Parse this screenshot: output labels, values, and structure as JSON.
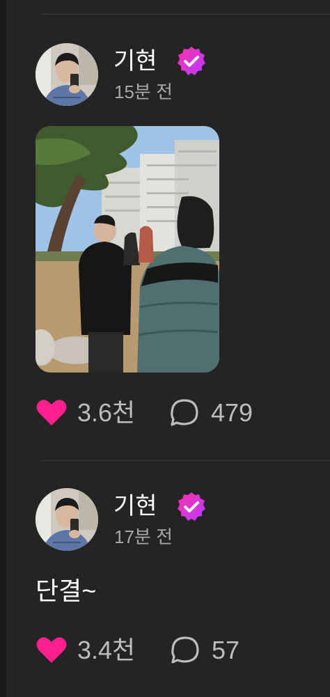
{
  "colors": {
    "background": "#242424",
    "like_heart": "#ff1f8e",
    "verified_badge": "#e23ce6",
    "muted_text": "#a8a8a8",
    "count_text": "#bdbdbd"
  },
  "posts": [
    {
      "author": "기현",
      "verified": true,
      "time": "15분 전",
      "text": "",
      "has_image": true,
      "likes": "3.6천",
      "comments": "479",
      "icons": [
        "avatar",
        "verified-badge-icon",
        "heart-icon",
        "comment-icon"
      ]
    },
    {
      "author": "기현",
      "verified": true,
      "time": "17분 전",
      "text": "단결~",
      "has_image": false,
      "likes": "3.4천",
      "comments": "57",
      "icons": [
        "avatar",
        "verified-badge-icon",
        "heart-icon",
        "comment-icon"
      ]
    }
  ]
}
